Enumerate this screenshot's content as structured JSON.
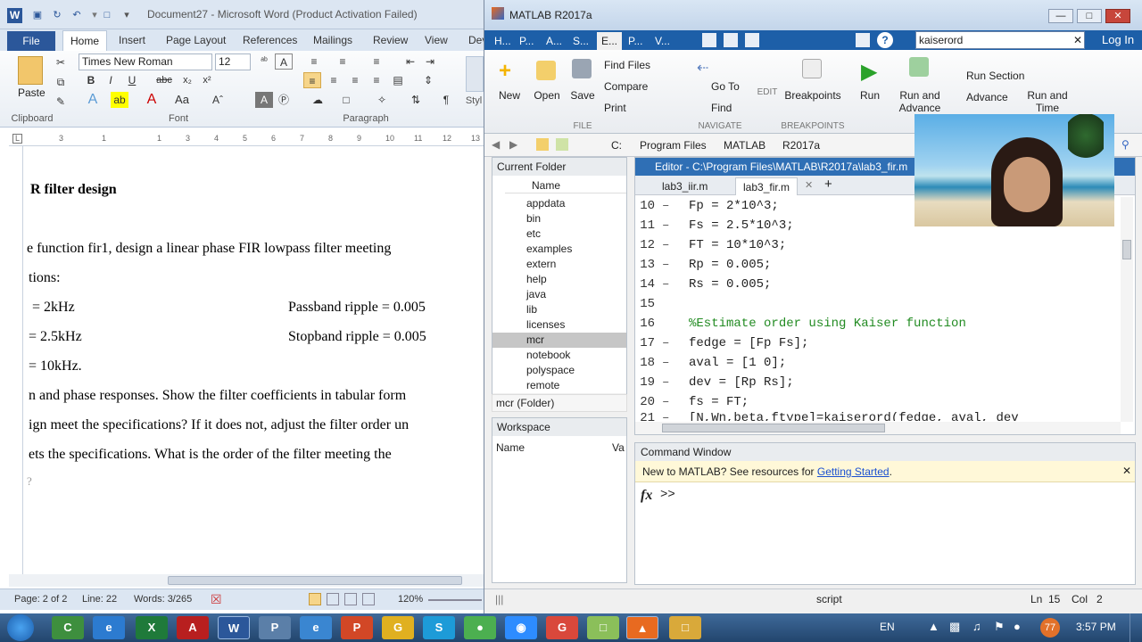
{
  "word": {
    "title": "Document27 - Microsoft Word (Product Activation Failed)",
    "app_icon": "W",
    "tabs": [
      "File",
      "Home",
      "Insert",
      "Page Layout",
      "References",
      "Mailings",
      "Review",
      "View",
      "Dev"
    ],
    "font_name": "Times New Roman",
    "font_size": "12",
    "paste_label": "Paste",
    "groups": {
      "clipboard": "Clipboard",
      "font": "Font",
      "paragraph": "Paragraph",
      "styles": "Styl"
    },
    "ruler_marks": [
      "3",
      "1",
      "2",
      "1",
      "2",
      "3",
      "4",
      "5",
      "6",
      "7",
      "8",
      "9",
      "10",
      "11",
      "12",
      "13"
    ],
    "doc_lines": [
      "R filter design",
      "e function fir1, design a linear phase FIR lowpass filter meeting",
      "tions:",
      "= 2kHz",
      "Passband ripple = 0.005",
      "= 2.5kHz",
      "Stopband ripple = 0.005",
      "= 10kHz.",
      "n and phase responses. Show the filter coefficients in tabular form",
      "ign meet the specifications? If it does not, adjust the filter order un",
      "ets the specifications.  What is the order of the filter meeting the",
      "?"
    ],
    "status": {
      "page": "Page: 2 of 2",
      "line": "Line: 22",
      "words": "Words: 3/265",
      "zoom": "120%"
    }
  },
  "matlab": {
    "title": "MATLAB R2017a",
    "app_tabs": [
      "H...",
      "P...",
      "A...",
      "S...",
      "E...",
      "P...",
      "V..."
    ],
    "search_value": "kaiserord",
    "login": "Log In",
    "file_section": {
      "new": "New",
      "open": "Open",
      "save": "Save",
      "find_files": "Find Files",
      "compare": "Compare",
      "print": "Print",
      "label": "FILE"
    },
    "navigate_section": {
      "goto": "Go To",
      "find": "Find",
      "label": "NAVIGATE"
    },
    "edit_label": "EDIT",
    "breakpoints": {
      "label": "Breakpoints",
      "section": "BREAKPOINTS"
    },
    "run": {
      "run": "Run",
      "run_advance": "Run and Advance",
      "run_section": "Run Section",
      "advance": "Advance",
      "run_time": "Run and Time"
    },
    "path": [
      "C:",
      "Program Files",
      "MATLAB",
      "R2017a"
    ],
    "current_folder": {
      "title": "Current Folder",
      "col": "Name",
      "items": [
        "appdata",
        "bin",
        "etc",
        "examples",
        "extern",
        "help",
        "java",
        "lib",
        "licenses",
        "mcr",
        "notebook",
        "polyspace",
        "remote"
      ],
      "selected": "mcr",
      "footer": "mcr  (Folder)"
    },
    "workspace": {
      "title": "Workspace",
      "col_name": "Name",
      "col_value": "Va"
    },
    "editor": {
      "title": "Editor - C:\\Program Files\\MATLAB\\R2017a\\lab3_fir.m",
      "tabs": [
        "lab3_iir.m",
        "lab3_fir.m"
      ],
      "active_tab": "lab3_fir.m",
      "lines": [
        {
          "n": "10",
          "code": "Fp = 2*10^3;"
        },
        {
          "n": "11",
          "code": "Fs = 2.5*10^3;"
        },
        {
          "n": "12",
          "code": "FT = 10*10^3;"
        },
        {
          "n": "13",
          "code": "Rp = 0.005;"
        },
        {
          "n": "14",
          "code": "Rs = 0.005;"
        },
        {
          "n": "15",
          "code": ""
        },
        {
          "n": "16",
          "code": "%Estimate order using Kaiser function"
        },
        {
          "n": "17",
          "code": "fedge = [Fp Fs];"
        },
        {
          "n": "18",
          "code": "aval  = [1 0];"
        },
        {
          "n": "19",
          "code": "dev   = [Rp Rs];"
        },
        {
          "n": "20",
          "code": "fs    = FT;"
        },
        {
          "n": "21",
          "code": "[N,Wn,beta,ftype]=kaiserord(fedge, aval, dev"
        }
      ],
      "comment_color": "#228b22"
    },
    "command_window": {
      "title": "Command Window",
      "banner": "New to MATLAB? See resources for",
      "link": "Getting Started",
      "banner_end": ".",
      "prompt": ">>",
      "fx": "fx"
    },
    "status": {
      "mode": "script",
      "ln": "Ln",
      "ln_val": "15",
      "col": "Col",
      "col_val": "2"
    }
  },
  "taskbar": {
    "lang": "EN",
    "time": "3:57 PM",
    "badge": "77",
    "apps": [
      "start-orb",
      "camtasia",
      "chrome-ie",
      "excel",
      "word",
      "acrobat",
      "paint",
      "ie",
      "powerpoint",
      "chrome",
      "skype",
      "green-app",
      "zoom",
      "chrome2",
      "folder-green",
      "matlab",
      "explorer"
    ]
  }
}
